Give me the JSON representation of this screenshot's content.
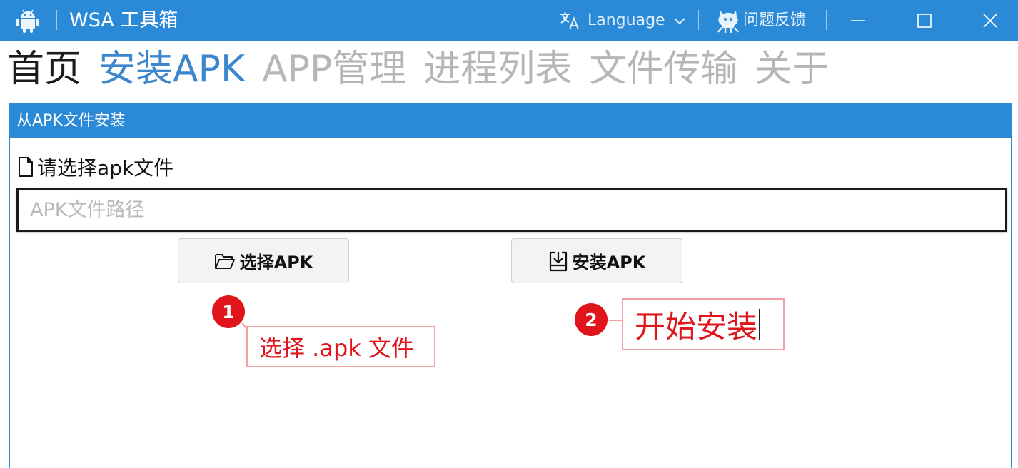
{
  "titlebar": {
    "title": "WSA 工具箱",
    "language_label": "Language",
    "feedback_label": "问题反馈",
    "bg_color": "#2b8ad8"
  },
  "nav": {
    "tabs": [
      {
        "label": "首页",
        "state": "home"
      },
      {
        "label": "安装APK",
        "state": "active"
      },
      {
        "label": "APP管理",
        "state": "inactive"
      },
      {
        "label": "进程列表",
        "state": "inactive"
      },
      {
        "label": "文件传输",
        "state": "inactive"
      },
      {
        "label": "关于",
        "state": "inactive"
      }
    ],
    "active_color": "#3b86cc"
  },
  "panel": {
    "header": "从APK文件安装",
    "file_label": "请选择apk文件",
    "path_placeholder": "APK文件路径",
    "path_value": "",
    "select_button": "选择APK",
    "install_button": "安装APK"
  },
  "annotations": [
    {
      "number": "1",
      "text": "选择 .apk 文件"
    },
    {
      "number": "2",
      "text": "开始安装"
    }
  ],
  "icons": {
    "app": "android-icon",
    "language": "translate-icon",
    "github": "github-octocat-icon",
    "file": "file-icon",
    "folder": "folder-open-icon",
    "install": "download-tray-icon"
  }
}
